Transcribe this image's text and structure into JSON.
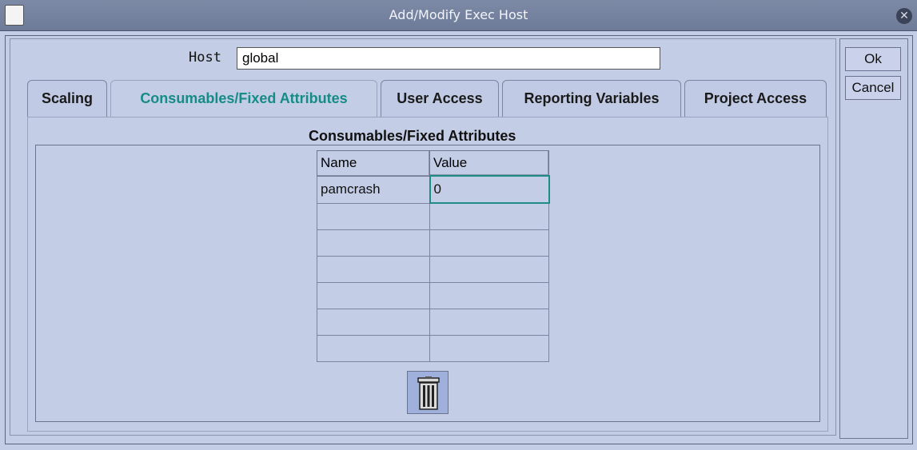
{
  "window": {
    "title": "Add/Modify Exec Host"
  },
  "host": {
    "label": "Host",
    "value": "global"
  },
  "tabs": [
    {
      "label": "Scaling"
    },
    {
      "label": "Consumables/Fixed Attributes"
    },
    {
      "label": "User Access"
    },
    {
      "label": "Reporting Variables"
    },
    {
      "label": "Project Access"
    }
  ],
  "active_tab": "Consumables/Fixed Attributes",
  "group": {
    "title": "Consumables/Fixed Attributes"
  },
  "table": {
    "columns": [
      "Name",
      "Value"
    ],
    "rows": [
      {
        "name": "pamcrash",
        "value": "0"
      }
    ]
  },
  "buttons": {
    "ok": "Ok",
    "cancel": "Cancel"
  },
  "icons": {
    "delete": "trash-icon",
    "close": "close-icon",
    "window_menu": "window-menu-icon"
  }
}
